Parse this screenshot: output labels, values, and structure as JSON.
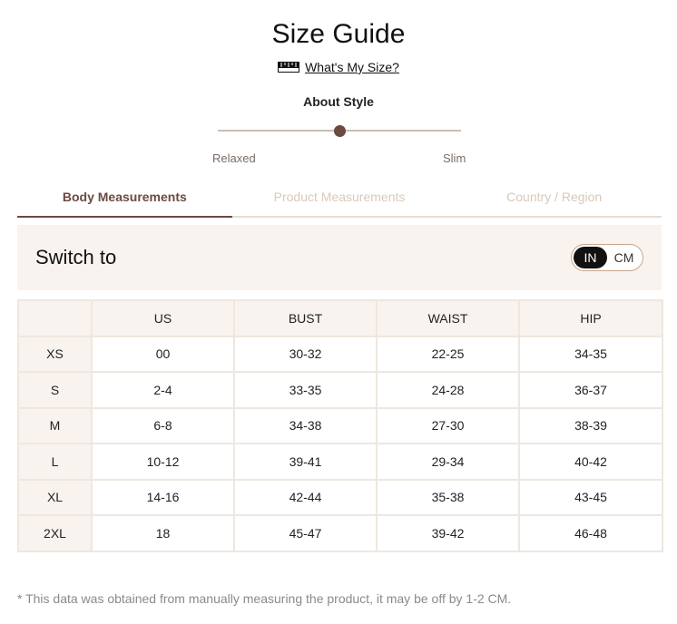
{
  "header": {
    "title": "Size Guide",
    "whats_my_size": "What's My Size?",
    "about_style": "About Style"
  },
  "style_slider": {
    "left_label": "Relaxed",
    "right_label": "Slim",
    "value": 0.5
  },
  "tabs": [
    {
      "label": "Body Measurements",
      "active": true
    },
    {
      "label": "Product Measurements",
      "active": false
    },
    {
      "label": "Country / Region",
      "active": false
    }
  ],
  "unit_switch": {
    "label": "Switch to",
    "options": [
      "IN",
      "CM"
    ],
    "selected": "IN"
  },
  "table": {
    "columns": [
      "",
      "US",
      "BUST",
      "WAIST",
      "HIP"
    ],
    "rows": [
      [
        "XS",
        "00",
        "30-32",
        "22-25",
        "34-35"
      ],
      [
        "S",
        "2-4",
        "33-35",
        "24-28",
        "36-37"
      ],
      [
        "M",
        "6-8",
        "34-38",
        "27-30",
        "38-39"
      ],
      [
        "L",
        "10-12",
        "39-41",
        "29-34",
        "40-42"
      ],
      [
        "XL",
        "14-16",
        "42-44",
        "35-38",
        "43-45"
      ],
      [
        "2XL",
        "18",
        "45-47",
        "39-42",
        "46-48"
      ]
    ]
  },
  "footnote": "* This data was obtained from manually measuring the product, it may be off by 1-2 CM.",
  "colors": {
    "accent": "#6b4a3f",
    "inactive_tab": "#d9c9b8",
    "panel_bg": "#f8f3ee",
    "grid": "#efe7df"
  }
}
